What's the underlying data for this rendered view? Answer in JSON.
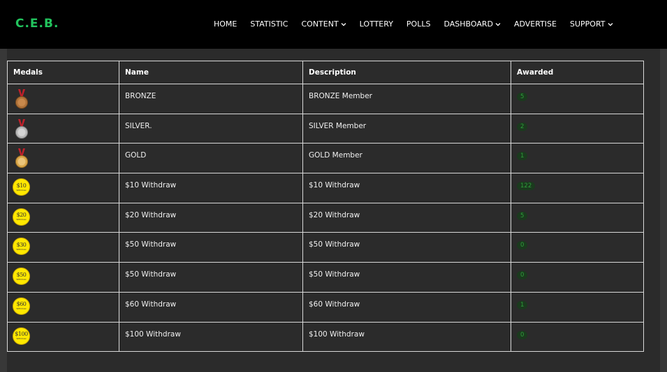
{
  "header": {
    "logo": "C.E.B.",
    "nav": [
      {
        "label": "HOME",
        "dropdown": false
      },
      {
        "label": "STATISTIC",
        "dropdown": false
      },
      {
        "label": "CONTENT",
        "dropdown": true
      },
      {
        "label": "LOTTERY",
        "dropdown": false
      },
      {
        "label": "POLLS",
        "dropdown": false
      },
      {
        "label": "DASHBOARD",
        "dropdown": true
      },
      {
        "label": "ADVERTISE",
        "dropdown": false
      },
      {
        "label": "SUPPORT",
        "dropdown": true
      }
    ]
  },
  "colors": {
    "brand": "#22c55e",
    "badge_text": "#2e9e3a",
    "badge_bg": "#1b3a1e",
    "coin": "#ffe800",
    "bronze": "#b0733a",
    "silver": "#b8b8b8",
    "gold": "#d9a74a",
    "ribbon": "#c0202a"
  },
  "table": {
    "headers": {
      "medals": "Medals",
      "name": "Name",
      "description": "Description",
      "awarded": "Awarded"
    },
    "rows": [
      {
        "icon": "bronze-medal-icon",
        "name": "BRONZE",
        "description": "BRONZE Member",
        "awarded": "5"
      },
      {
        "icon": "silver-medal-icon",
        "name": "SILVER.",
        "description": "SILVER Member",
        "awarded": "2"
      },
      {
        "icon": "gold-medal-icon",
        "name": "GOLD",
        "description": "GOLD Member",
        "awarded": "1"
      },
      {
        "icon": "coin-10-icon",
        "coin_label": "$10",
        "coin_sub": "Withdraw",
        "name": "$10 Withdraw",
        "description": "$10 Withdraw",
        "awarded": "122"
      },
      {
        "icon": "coin-20-icon",
        "coin_label": "$20",
        "coin_sub": "Withdraw",
        "name": "$20 Withdraw",
        "description": "$20 Withdraw",
        "awarded": "5"
      },
      {
        "icon": "coin-30-icon",
        "coin_label": "$30",
        "coin_sub": "Withdraw",
        "name": "$50 Withdraw",
        "description": "$50 Withdraw",
        "awarded": "0"
      },
      {
        "icon": "coin-50-icon",
        "coin_label": "$50",
        "coin_sub": "Withdraw",
        "name": "$50 Withdraw",
        "description": "$50 Withdraw",
        "awarded": "0"
      },
      {
        "icon": "coin-60-icon",
        "coin_label": "$60",
        "coin_sub": "Withdraw",
        "name": "$60 Withdraw",
        "description": "$60 Withdraw",
        "awarded": "1"
      },
      {
        "icon": "coin-100-icon",
        "coin_label": "$100",
        "coin_sub": "Withdraw",
        "name": "$100 Withdraw",
        "description": "$100 Withdraw",
        "awarded": "0"
      }
    ]
  }
}
